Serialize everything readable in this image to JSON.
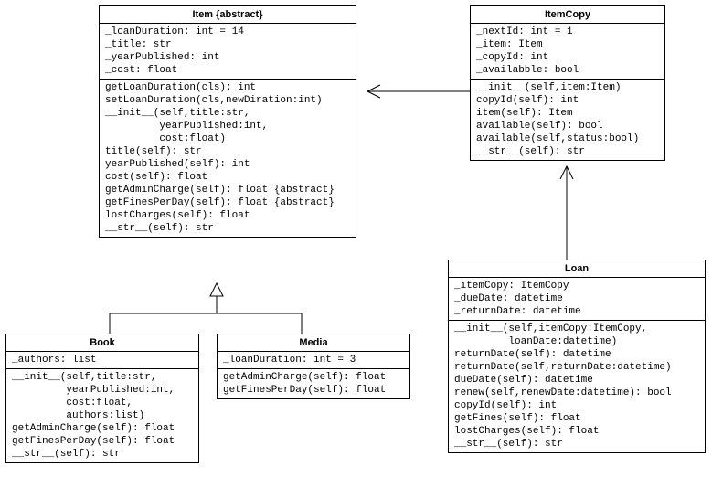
{
  "item": {
    "title": "Item {abstract}",
    "attrs": "_loanDuration: int = 14\n_title: str\n_yearPublished: int\n_cost: float",
    "ops": "getLoanDuration(cls): int\nsetLoanDuration(cls,newDiration:int)\n__init__(self,title:str,\n         yearPublished:int,\n         cost:float)\ntitle(self): str\nyearPublished(self): int\ncost(self): float\ngetAdminCharge(self): float {abstract}\ngetFinesPerDay(self): float {abstract}\nlostCharges(self): float\n__str__(self): str"
  },
  "itemcopy": {
    "title": "ItemCopy",
    "attrs": "_nextId: int = 1\n_item: Item\n_copyId: int\n_availabble: bool",
    "ops": "__init__(self,item:Item)\ncopyId(self): int\nitem(self): Item\navailable(self): bool\navailable(self,status:bool)\n__str__(self): str"
  },
  "book": {
    "title": "Book",
    "attrs": "_authors: list",
    "ops": "__init__(self,title:str,\n         yearPublished:int,\n         cost:float,\n         authors:list)\ngetAdminCharge(self): float\ngetFinesPerDay(self): float\n__str__(self): str"
  },
  "media": {
    "title": "Media",
    "attrs": "_loanDuration: int = 3",
    "ops": "getAdminCharge(self): float\ngetFinesPerDay(self): float"
  },
  "loan": {
    "title": "Loan",
    "attrs": "_itemCopy: ItemCopy\n_dueDate: datetime\n_returnDate: datetime",
    "ops": "__init__(self,itemCopy:ItemCopy,\n         loanDate:datetime)\nreturnDate(self): datetime\nreturnDate(self,returnDate:datetime)\ndueDate(self): datetime\nrenew(self,renewDate:datetime): bool\ncopyId(self): int\ngetFines(self): float\nlostCharges(self): float\n__str__(self): str"
  }
}
